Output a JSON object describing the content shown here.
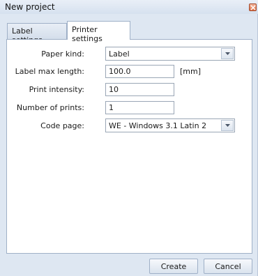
{
  "window": {
    "title": "New project"
  },
  "tabs": [
    {
      "label": "Label settings",
      "active": false
    },
    {
      "label": "Printer settings",
      "active": true
    }
  ],
  "form": {
    "paper_kind": {
      "label": "Paper kind:",
      "value": "Label"
    },
    "label_max_length": {
      "label": "Label max length:",
      "value": "100.0",
      "unit": "[mm]"
    },
    "print_intensity": {
      "label": "Print intensity:",
      "value": "10"
    },
    "number_of_prints": {
      "label": "Number of prints:",
      "value": "1"
    },
    "code_page": {
      "label": "Code page:",
      "value": "WE - Windows 3.1 Latin 2"
    }
  },
  "buttons": {
    "create": "Create",
    "cancel": "Cancel"
  },
  "colors": {
    "dialog_bg": "#dee7f2",
    "border": "#9fb0c7",
    "close": "#dd6e44"
  }
}
